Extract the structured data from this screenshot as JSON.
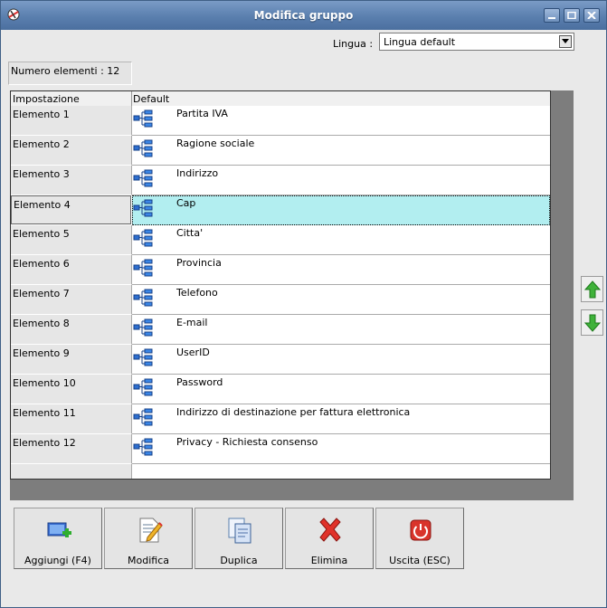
{
  "window": {
    "title": "Modifica gruppo"
  },
  "language": {
    "label": "Lingua :",
    "value": "Lingua default"
  },
  "count_label": "Numero elementi : 12",
  "grid": {
    "columns": [
      "Impostazione",
      "Default"
    ],
    "selected_index": 3,
    "rows": [
      {
        "setting": "Elemento 1",
        "value": "Partita IVA"
      },
      {
        "setting": "Elemento 2",
        "value": "Ragione sociale"
      },
      {
        "setting": "Elemento 3",
        "value": "Indirizzo"
      },
      {
        "setting": "Elemento 4",
        "value": "Cap"
      },
      {
        "setting": "Elemento 5",
        "value": "Citta'"
      },
      {
        "setting": "Elemento 6",
        "value": "Provincia"
      },
      {
        "setting": "Elemento 7",
        "value": "Telefono"
      },
      {
        "setting": "Elemento 8",
        "value": "E-mail"
      },
      {
        "setting": "Elemento 9",
        "value": "UserID"
      },
      {
        "setting": "Elemento 10",
        "value": "Password"
      },
      {
        "setting": "Elemento 11",
        "value": "Indirizzo di destinazione per fattura elettronica"
      },
      {
        "setting": "Elemento 12",
        "value": "Privacy - Richiesta consenso"
      }
    ]
  },
  "buttons": {
    "add": "Aggiungi (F4)",
    "edit": "Modifica",
    "duplicate": "Duplica",
    "delete": "Elimina",
    "exit": "Uscita (ESC)"
  },
  "icons": {
    "app": "app-logo-icon",
    "row": "hierarchy-icon",
    "move_up": "arrow-up-icon",
    "move_down": "arrow-down-icon"
  },
  "colors": {
    "titlebar": "#5a7fae",
    "selection": "#b2eef0",
    "arrow_green": "#3fb23a",
    "delete_red": "#e0322a",
    "exit_red": "#d9342b"
  }
}
